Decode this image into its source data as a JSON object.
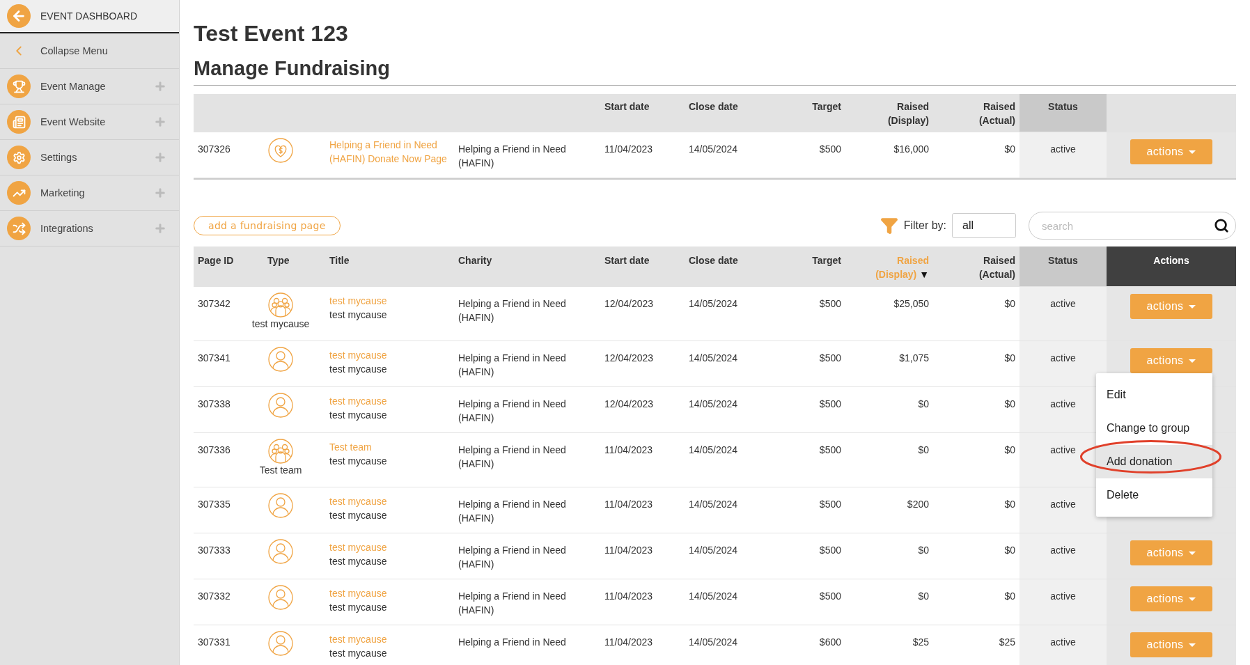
{
  "sidebar": {
    "header": "EVENT DASHBOARD",
    "collapse": "Collapse Menu",
    "items": [
      {
        "label": "Event Manage",
        "kind": "trophy"
      },
      {
        "label": "Event Website",
        "kind": "website"
      },
      {
        "label": "Settings",
        "kind": "gear"
      },
      {
        "label": "Marketing",
        "kind": "chart"
      },
      {
        "label": "Integrations",
        "kind": "shuffle"
      }
    ]
  },
  "title": "Test Event 123",
  "subtitle": "Manage Fundraising",
  "summary_table": {
    "columns": [
      "",
      "",
      "",
      "",
      "Start date",
      "Close date",
      "Target",
      "Raised (Display)",
      "Raised (Actual)",
      "Status",
      ""
    ],
    "row": {
      "page_id": "307326",
      "kind": "donate",
      "title": "Helping a Friend in Need (HAFIN) Donate Now Page",
      "charity": "Helping a Friend in Need (HAFIN)",
      "start": "11/04/2023",
      "close": "14/05/2024",
      "target": "$500",
      "raised_display": "$16,000",
      "raised_actual": "$0",
      "status": "active",
      "actions": "actions"
    }
  },
  "add_button": "add a fundraising page",
  "filter": {
    "label": "Filter by:",
    "value": "all"
  },
  "search": {
    "placeholder": "search"
  },
  "table": {
    "columns": [
      {
        "label": "Page ID",
        "sorted": false
      },
      {
        "label": "Type",
        "sorted": false
      },
      {
        "label": "Title",
        "sorted": false
      },
      {
        "label": "Charity",
        "sorted": false
      },
      {
        "label": "Start date",
        "sorted": false
      },
      {
        "label": "Close date",
        "sorted": false
      },
      {
        "label": "Target",
        "sorted": false
      },
      {
        "label": "Raised (Display)",
        "sorted": true,
        "sort_mark": "▼"
      },
      {
        "label": "Raised (Actual)",
        "sorted": false
      },
      {
        "label": "Status",
        "sorted": false
      },
      {
        "label": "Actions",
        "sorted": false
      }
    ],
    "rows": [
      {
        "page_id": "307342",
        "kind": "group",
        "type_caption": "test mycause",
        "title": "test mycause",
        "subtitle": "test mycause",
        "charity": "Helping a Friend in Need (HAFIN)",
        "start": "12/04/2023",
        "close": "14/05/2024",
        "target": "$500",
        "raised_display": "$25,050",
        "raised_actual": "$0",
        "status": "active",
        "actions": "actions"
      },
      {
        "page_id": "307341",
        "kind": "person",
        "title": "test mycause",
        "subtitle": "test mycause",
        "charity": "Helping a Friend in Need (HAFIN)",
        "start": "12/04/2023",
        "close": "14/05/2024",
        "target": "$500",
        "raised_display": "$1,075",
        "raised_actual": "$0",
        "status": "active",
        "actions": "actions"
      },
      {
        "page_id": "307338",
        "kind": "person",
        "title": "test mycause",
        "subtitle": "test mycause",
        "charity": "Helping a Friend in Need (HAFIN)",
        "start": "12/04/2023",
        "close": "14/05/2024",
        "target": "$500",
        "raised_display": "$0",
        "raised_actual": "$0",
        "status": "active"
      },
      {
        "page_id": "307336",
        "kind": "group",
        "type_caption": "Test team",
        "title": "Test team",
        "subtitle": "test mycause",
        "charity": "Helping a Friend in Need (HAFIN)",
        "start": "11/04/2023",
        "close": "14/05/2024",
        "target": "$500",
        "raised_display": "$0",
        "raised_actual": "$0",
        "status": "active"
      },
      {
        "page_id": "307335",
        "kind": "person",
        "title": "test mycause",
        "subtitle": "test mycause",
        "charity": "Helping a Friend in Need (HAFIN)",
        "start": "11/04/2023",
        "close": "14/05/2024",
        "target": "$500",
        "raised_display": "$200",
        "raised_actual": "$0",
        "status": "active"
      },
      {
        "page_id": "307333",
        "kind": "person",
        "title": "test mycause",
        "subtitle": "test mycause",
        "charity": "Helping a Friend in Need (HAFIN)",
        "start": "11/04/2023",
        "close": "14/05/2024",
        "target": "$500",
        "raised_display": "$0",
        "raised_actual": "$0",
        "status": "active",
        "actions": "actions"
      },
      {
        "page_id": "307332",
        "kind": "person",
        "title": "test mycause",
        "subtitle": "test mycause",
        "charity": "Helping a Friend in Need (HAFIN)",
        "start": "11/04/2023",
        "close": "14/05/2024",
        "target": "$500",
        "raised_display": "$0",
        "raised_actual": "$0",
        "status": "active",
        "actions": "actions"
      },
      {
        "page_id": "307331",
        "kind": "person",
        "title": "test mycause",
        "subtitle": "test mycause",
        "charity": "Helping a Friend in Need",
        "start": "11/04/2023",
        "close": "14/05/2024",
        "target": "$600",
        "raised_display": "$25",
        "raised_actual": "$25",
        "status": "active",
        "actions": "actions"
      }
    ]
  },
  "actions_menu": {
    "items": [
      {
        "label": "Edit",
        "selected": false,
        "circled": false
      },
      {
        "label": "Change to group",
        "selected": false,
        "circled": false
      },
      {
        "label": "Add donation",
        "selected": true,
        "circled": true
      },
      {
        "label": "Delete",
        "selected": false,
        "circled": false
      }
    ]
  }
}
